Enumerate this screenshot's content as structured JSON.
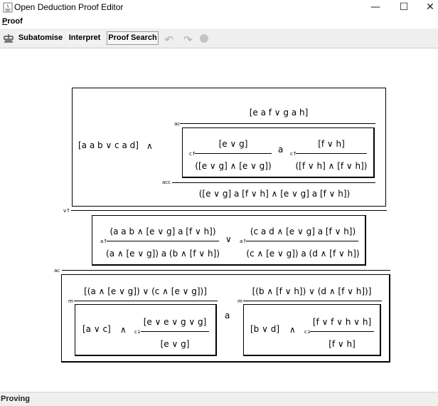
{
  "window": {
    "title": "Open Deduction Proof Editor",
    "minimize": "—",
    "maximize": "☐",
    "close": "✕"
  },
  "menu": {
    "proof_first": "P",
    "proof_rest": "roof"
  },
  "toolbar": {
    "subatomise": "Subatomise",
    "interpret": "Interpret",
    "proof_search": "Proof Search"
  },
  "status": {
    "text": "Proving"
  },
  "proof": {
    "top": {
      "left_formula": "[a a b ∨ c a d]",
      "and": "∧",
      "ac_label": "ac",
      "premise": "[e a f ∨ g a h]",
      "inner": {
        "left_num": "[e ∨ g]",
        "left_den": "([e ∨ g] ∧ [e ∨ g])",
        "left_rule": "c↑",
        "mid": "a",
        "right_num": "[f ∨ h]",
        "right_den": "([f ∨ h] ∧ [f ∨ h])",
        "right_rule": "c↑"
      },
      "acc_label": "acc",
      "conclusion": "([e ∨ g] a [f ∨ h] ∧ [e ∨ g] a [f ∨ h])"
    },
    "v_label": "v↑",
    "middle": {
      "left_num": "(a a b ∧ [e ∨ g] a [f ∨ h])",
      "left_den": "(a ∧ [e ∨ g]) a (b ∧ [f ∨ h])",
      "left_rule": "a↑",
      "or": "∨",
      "right_num": "(c a d ∧ [e ∨ g] a [f ∨ h])",
      "right_den": "(c ∧ [e ∨ g]) a (d ∧ [f ∨ h])",
      "right_rule": "a↑"
    },
    "ac_label2": "ac",
    "bottom": {
      "left_top": "[(a ∧ [e ∨ g]) ∨ (c ∧ [e ∨ g])]",
      "left_m": "m",
      "left_inner": {
        "formula": "[a ∨ c]",
        "and": "∧",
        "rule": "c↓",
        "num": "[e ∨ e ∨ g ∨ g]",
        "den": "[e ∨ g]"
      },
      "mid": "a",
      "right_top": "[(b ∧ [f ∨ h]) ∨ (d ∧ [f ∨ h])]",
      "right_m": "m",
      "right_inner": {
        "formula": "[b ∨ d]",
        "and": "∧",
        "rule": "c↓",
        "num": "[f ∨ f ∨ h ∨ h]",
        "den": "[f ∨ h]"
      }
    }
  }
}
